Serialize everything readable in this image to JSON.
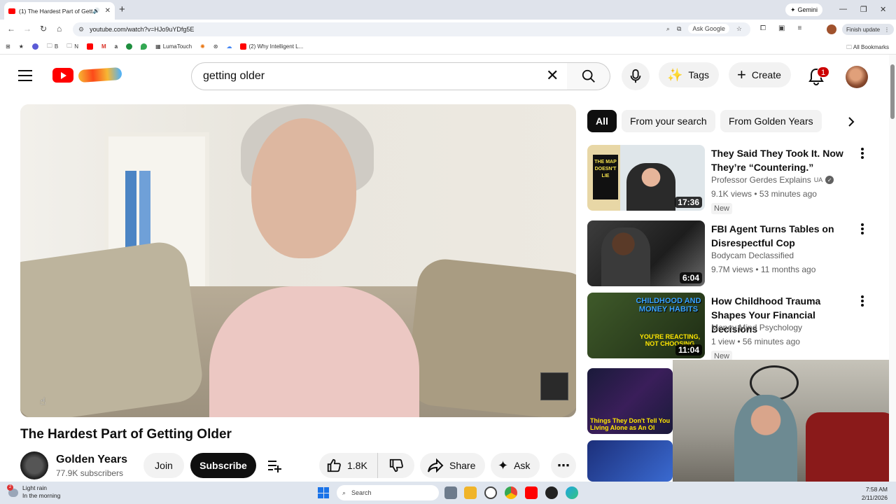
{
  "browser": {
    "tab_title": "(1) The Hardest Part of Getti",
    "new_tab": "+",
    "gemini": "Gemini",
    "url": "youtube.com/watch?v=HJo9uYDfg5E",
    "ask_google": "Ask Google",
    "finish_update": "Finish update",
    "bookmarks": [
      "B",
      "N",
      "LumaTouch",
      "(2) Why Intelligent L..."
    ],
    "all_bookmarks": "All Bookmarks"
  },
  "header": {
    "search_value": "getting older",
    "tags_label": "Tags",
    "create_label": "Create",
    "notification_count": "1"
  },
  "video": {
    "title": "The Hardest Part of Getting Older",
    "channel_name": "Golden Years",
    "subscribers": "77.9K subscribers",
    "join_label": "Join",
    "subscribe_label": "Subscribe",
    "likes": "1.8K",
    "share_label": "Share",
    "ask_label": "Ask"
  },
  "chips": [
    {
      "label": "All"
    },
    {
      "label": "From your search"
    },
    {
      "label": "From Golden Years"
    }
  ],
  "recommendations": [
    {
      "title": "They Said They Took It. Now They’re “Countering.”",
      "channel": "Professor Gerdes Explains",
      "channel_suffix": "UA",
      "meta": "9.1K views • 53 minutes ago",
      "badge": "New",
      "duration": "17:36",
      "thumb_text": "THE MAP DOESN'T LIE"
    },
    {
      "title": "FBI Agent Turns Tables on Disrespectful Cop",
      "channel": "Bodycam Declassified",
      "meta": "9.7M views • 11 months ago",
      "duration": "6:04"
    },
    {
      "title": "How Childhood Trauma Shapes Your Financial Decisions",
      "channel": "Money Mind Psychology",
      "meta": "1 view • 56 minutes ago",
      "badge": "New",
      "duration": "11:04",
      "thumb_text": "CHILDHOOD AND MONEY HABITS",
      "thumb_text2": "YOU'RE REACTING, NOT CHOOSING"
    },
    {
      "thumb_text": "Things They Don't Tell You Living Alone as An Ol"
    }
  ],
  "taskbar": {
    "weather_title": "Light rain",
    "weather_sub": "In the morning",
    "weather_badge": "2",
    "search_placeholder": "Search",
    "time": "7:58 AM",
    "date": "2/11/2026"
  }
}
